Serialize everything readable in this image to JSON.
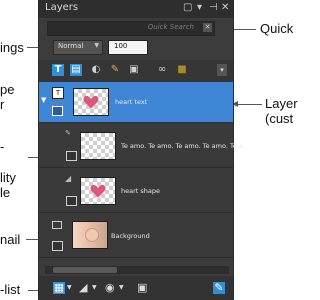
{
  "panel": {
    "title": "Layers",
    "search_placeholder": "Quick Search",
    "blend_mode": "Normal",
    "opacity": "100"
  },
  "layers": [
    {
      "name": "heart text",
      "selected": true
    },
    {
      "name": "Te amo. Te amo. Te amo. Te amo. Te a",
      "selected": false
    },
    {
      "name": "heart shape",
      "selected": false
    },
    {
      "name": "Background",
      "selected": false
    }
  ],
  "callouts": {
    "quick": "Quick",
    "ings": "ings",
    "pe": "pe",
    "r": "r",
    "layer": "Layer",
    "cust": "(cust",
    "dash": "-",
    "lity": "lity",
    "le": "le",
    "nail": "nail",
    "list": "-list"
  },
  "icons": {
    "titlebar": [
      "panel-menu-icon",
      "collapse-icon",
      "pin-icon",
      "close-icon"
    ],
    "toolbar": [
      "layer-type-icon",
      "effects-icon",
      "mask-icon",
      "brush-icon",
      "filter-icon",
      "link-icon",
      "lock-icon",
      "toolbar-menu-icon"
    ],
    "bottom": [
      "new-layer-icon",
      "adjust-icon",
      "mask-add-icon",
      "merge-icon",
      "delete-layer-icon"
    ]
  }
}
